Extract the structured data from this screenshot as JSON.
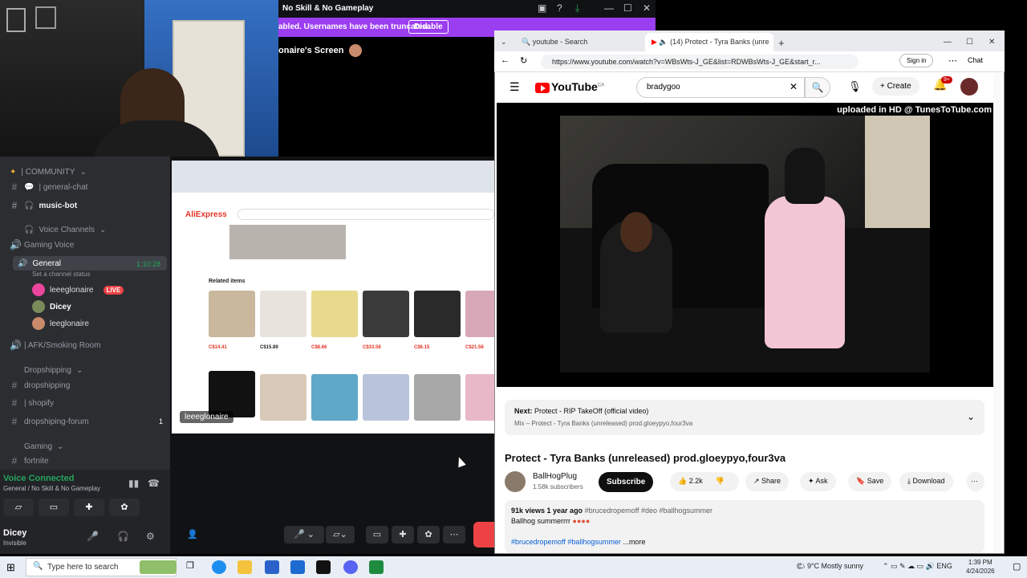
{
  "discord": {
    "window_title": "No Skill & No Gameplay",
    "banner_text": "abled. Usernames have been truncated.",
    "banner_button": "Disable",
    "screen_label": "onaire's Screen",
    "sidebar": {
      "community": "| COMMUNITY",
      "general_chat": "| general-chat",
      "music_bot": "music-bot",
      "voice_channels": "Voice Channels",
      "gaming_voice": "Gaming Voice",
      "general": "General",
      "timer": "1:10:28",
      "channel_status": "Set a channel status",
      "user1": "leeeglonaire",
      "live": "LIVE",
      "user2": "Dicey",
      "user3": "leeglonaire",
      "afk": "| AFK/Smoking Room",
      "dropshipping_cat": "Dropshipping",
      "dropshipping": "dropshipping",
      "shopify": "| shopify",
      "forum": "dropshiping-forum",
      "forum_badge": "1",
      "gaming_cat": "Gaming",
      "fortnite": "fortnite"
    },
    "voice": {
      "status": "Voice Connected",
      "location": "General / No Skill & No Gameplay",
      "user": "Dicey",
      "user_status": "Invisible"
    },
    "shared_name": "leeeglonaire",
    "shared": {
      "logo": "AliExpress",
      "related": "Related items",
      "prices": [
        "C$14.41",
        "C$15.89",
        "C$8.66",
        "C$33.58",
        "C$6.15",
        "C$21.58"
      ]
    }
  },
  "browser": {
    "tab1": "youtube - Search",
    "tab2": "(14) Protect - Tyra Banks (unre",
    "url": "https://www.youtube.com/watch?v=WBsWts-J_GE&list=RDWBsWts-J_GE&start_r...",
    "signin": "Sign in",
    "chat": "Chat"
  },
  "youtube": {
    "logo": "YouTube",
    "logo_region": "CA",
    "search_value": "bradygoo",
    "create": "Create",
    "notif_count": "9+",
    "watermark": "uploaded in HD @ TunesToTube.com",
    "next_label": "Next:",
    "next_title": "Protect - RIP TakeOff (official video)",
    "next_mix": "Mix – Protect - Tyra Banks (unreleased) prod.gloeypyo,four3va",
    "title": "Protect - Tyra Banks (unreleased) prod.gloeypyo,four3va",
    "channel": "BallHogPlug",
    "subs": "1.58k subscribers",
    "subscribe": "Subscribe",
    "likes": "2.2k",
    "share": "Share",
    "ask": "Ask",
    "save": "Save",
    "download": "Download",
    "views": "91k views  1 year ago",
    "tags": "#brucedropemoff #deo #ballhogsummer",
    "desc_line": "Ballhog summerrrr",
    "desc_tags2": "#brucedropemoff #ballhogsummer",
    "more": "...more"
  },
  "taskbar": {
    "search": "Type here to search",
    "weather": "9°C  Mostly sunny",
    "lang": "ENG",
    "time": "1:39 PM",
    "date": "4/24/2026"
  }
}
